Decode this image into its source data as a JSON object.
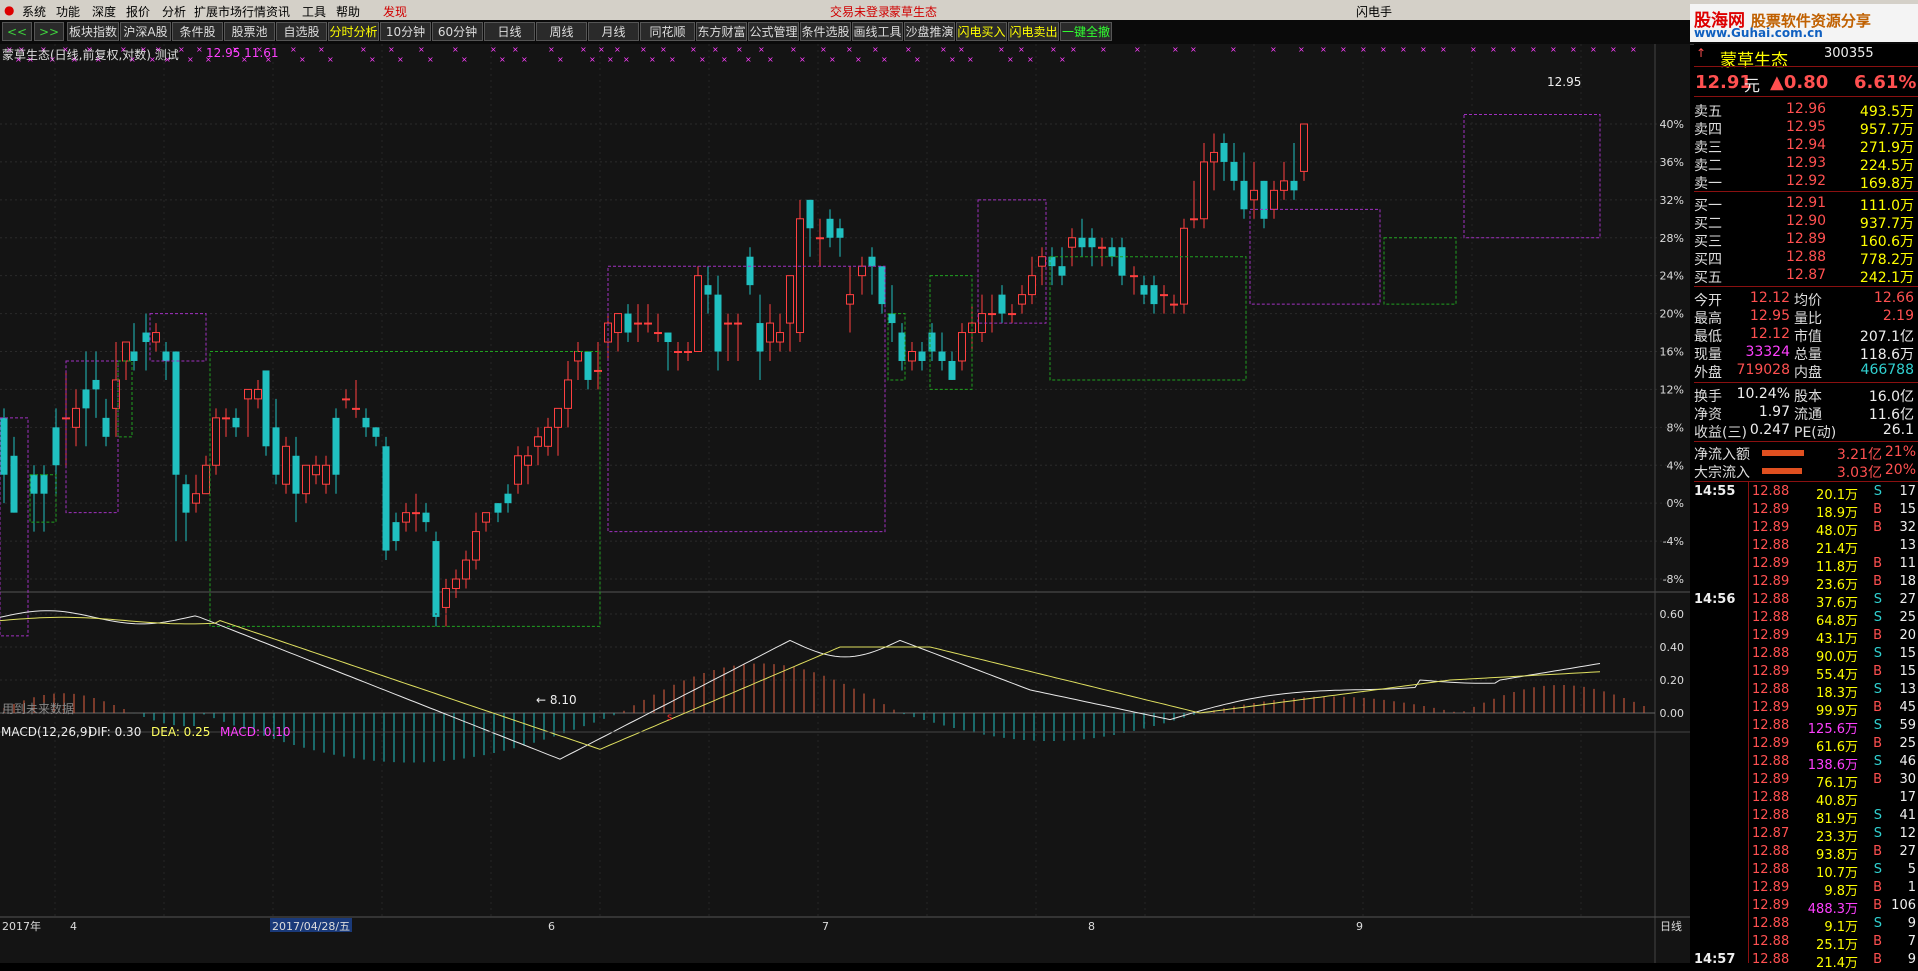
{
  "menu": {
    "items": [
      "系统",
      "功能",
      "深度",
      "报价",
      "分析",
      "扩展市场行情",
      "资讯",
      "工具",
      "帮助"
    ],
    "highlight": "发现",
    "status": "交易未登录",
    "stock_name": "蒙草生态",
    "right_label": "闪电手"
  },
  "toolbar": {
    "nav_prev": "<<",
    "nav_next": ">>",
    "buttons": [
      "板块指数",
      "沪深A股",
      "条件股",
      "股票池",
      "自选股",
      "分时分析",
      "10分钟",
      "60分钟",
      "日线",
      "周线",
      "月线",
      "同花顺",
      "东方财富",
      "公式管理",
      "条件选股",
      "画线工具",
      "沙盘推演",
      "闪电买入",
      "闪电卖出",
      "一键全撤"
    ]
  },
  "logo": {
    "line1": "股海网",
    "line1b": "股票软件资源分享",
    "line2": "www.Guhai.com.cn"
  },
  "chart_header": {
    "title": "蒙草生态(日线,前复权,对数) 测试",
    "values": "12.95  11.61",
    "future_note": "用到未来数据",
    "high_label": "12.95",
    "low_label": "← 8.10",
    "marker": "s"
  },
  "y_axis": [
    "40%",
    "36%",
    "32%",
    "28%",
    "24%",
    "20%",
    "16%",
    "12%",
    "8%",
    "4%",
    "0%",
    "-4%",
    "-8%"
  ],
  "macd": {
    "title": "MACD(12,26,9)",
    "dif": "DIF: 0.30",
    "dea": "DEA: 0.25",
    "macd": "MACD: 0.10",
    "y_axis": [
      "0.60",
      "0.40",
      "0.20",
      "0.00"
    ]
  },
  "x_axis": {
    "labels": [
      "2017年",
      "4",
      "2017/04/28/五",
      "6",
      "7",
      "8",
      "9"
    ],
    "period": "日线"
  },
  "chart_data": {
    "type": "candlestick",
    "indicator": "MACD(12,26,9)",
    "price_range_pct": [
      -8,
      40
    ],
    "high": 12.95,
    "low": 8.1,
    "macd_range": [
      0.0,
      0.6
    ],
    "series": [
      {
        "name": "DIF",
        "value": 0.3
      },
      {
        "name": "DEA",
        "value": 0.25
      },
      {
        "name": "MACD",
        "value": 0.1
      }
    ]
  },
  "quote": {
    "code": "300355",
    "name": "蒙草生态",
    "price": "12.91",
    "price_unit": "元",
    "change": "▲0.80",
    "change_pct": "6.61%",
    "asks": [
      {
        "label": "卖五",
        "price": "12.96",
        "vol": "493.5万"
      },
      {
        "label": "卖四",
        "price": "12.95",
        "vol": "957.7万"
      },
      {
        "label": "卖三",
        "price": "12.94",
        "vol": "271.9万"
      },
      {
        "label": "卖二",
        "price": "12.93",
        "vol": "224.5万"
      },
      {
        "label": "卖一",
        "price": "12.92",
        "vol": "169.8万"
      }
    ],
    "bids": [
      {
        "label": "买一",
        "price": "12.91",
        "vol": "111.0万"
      },
      {
        "label": "买二",
        "price": "12.90",
        "vol": "937.7万"
      },
      {
        "label": "买三",
        "price": "12.89",
        "vol": "160.6万"
      },
      {
        "label": "买四",
        "price": "12.88",
        "vol": "778.2万"
      },
      {
        "label": "买五",
        "price": "12.87",
        "vol": "242.1万"
      }
    ],
    "stats": [
      {
        "l1": "今开",
        "v1": "12.12",
        "l2": "均价",
        "v2": "12.66"
      },
      {
        "l1": "最高",
        "v1": "12.95",
        "l2": "量比",
        "v2": "2.19"
      },
      {
        "l1": "最低",
        "v1": "12.12",
        "l2": "市值",
        "v2": "207.1亿"
      },
      {
        "l1": "现量",
        "v1": "33324",
        "l2": "总量",
        "v2": "118.6万"
      },
      {
        "l1": "外盘",
        "v1": "719028",
        "l2": "内盘",
        "v2": "466788"
      }
    ],
    "fund": [
      {
        "l1": "换手",
        "v1": "10.24%",
        "l2": "股本",
        "v2": "16.0亿"
      },
      {
        "l1": "净资",
        "v1": "1.97",
        "l2": "流通",
        "v2": "11.6亿"
      },
      {
        "l1": "收益(三)",
        "v1": "0.247",
        "l2": "PE(动)",
        "v2": "26.1"
      }
    ],
    "flows": [
      {
        "label": "净流入额",
        "value": "3.21亿",
        "pct": "21%"
      },
      {
        "label": "大宗流入",
        "value": "3.03亿",
        "pct": "20%"
      }
    ],
    "ticks": [
      {
        "t": "14:55",
        "p": "12.88",
        "v": "20.1万",
        "d": "S",
        "n": "17"
      },
      {
        "t": "",
        "p": "12.89",
        "v": "18.9万",
        "d": "B",
        "n": "15"
      },
      {
        "t": "",
        "p": "12.89",
        "v": "48.0万",
        "d": "B",
        "n": "32"
      },
      {
        "t": "",
        "p": "12.88",
        "v": "21.4万",
        "d": "",
        "n": "13"
      },
      {
        "t": "",
        "p": "12.89",
        "v": "11.8万",
        "d": "B",
        "n": "11"
      },
      {
        "t": "",
        "p": "12.89",
        "v": "23.6万",
        "d": "B",
        "n": "18"
      },
      {
        "t": "14:56",
        "p": "12.88",
        "v": "37.6万",
        "d": "S",
        "n": "27"
      },
      {
        "t": "",
        "p": "12.88",
        "v": "64.8万",
        "d": "S",
        "n": "25"
      },
      {
        "t": "",
        "p": "12.89",
        "v": "43.1万",
        "d": "B",
        "n": "20"
      },
      {
        "t": "",
        "p": "12.88",
        "v": "90.0万",
        "d": "S",
        "n": "15"
      },
      {
        "t": "",
        "p": "12.89",
        "v": "55.4万",
        "d": "B",
        "n": "15"
      },
      {
        "t": "",
        "p": "12.88",
        "v": "18.3万",
        "d": "S",
        "n": "13"
      },
      {
        "t": "",
        "p": "12.89",
        "v": "99.9万",
        "d": "B",
        "n": "45"
      },
      {
        "t": "",
        "p": "12.88",
        "v": "125.6万",
        "d": "S",
        "n": "59"
      },
      {
        "t": "",
        "p": "12.89",
        "v": "61.6万",
        "d": "B",
        "n": "25"
      },
      {
        "t": "",
        "p": "12.88",
        "v": "138.6万",
        "d": "S",
        "n": "46"
      },
      {
        "t": "",
        "p": "12.89",
        "v": "76.1万",
        "d": "B",
        "n": "30"
      },
      {
        "t": "",
        "p": "12.88",
        "v": "40.8万",
        "d": "",
        "n": "17"
      },
      {
        "t": "",
        "p": "12.88",
        "v": "81.9万",
        "d": "S",
        "n": "41"
      },
      {
        "t": "",
        "p": "12.87",
        "v": "23.3万",
        "d": "S",
        "n": "12"
      },
      {
        "t": "",
        "p": "12.88",
        "v": "93.8万",
        "d": "B",
        "n": "27"
      },
      {
        "t": "",
        "p": "12.88",
        "v": "10.7万",
        "d": "S",
        "n": "5"
      },
      {
        "t": "",
        "p": "12.89",
        "v": "9.8万",
        "d": "B",
        "n": "1"
      },
      {
        "t": "",
        "p": "12.89",
        "v": "488.3万",
        "d": "B",
        "n": "106"
      },
      {
        "t": "",
        "p": "12.88",
        "v": "9.1万",
        "d": "S",
        "n": "9"
      },
      {
        "t": "",
        "p": "12.88",
        "v": "25.1万",
        "d": "B",
        "n": "7"
      },
      {
        "t": "14:57",
        "p": "12.88",
        "v": "21.4万",
        "d": "B",
        "n": "9"
      }
    ]
  },
  "colors": {
    "up": "#ff4040",
    "down": "#20c0c0",
    "box_green": "#20a020",
    "box_purple": "#a030c0",
    "dif_line": "#e8e8e8",
    "dea_line": "#e0e060"
  }
}
